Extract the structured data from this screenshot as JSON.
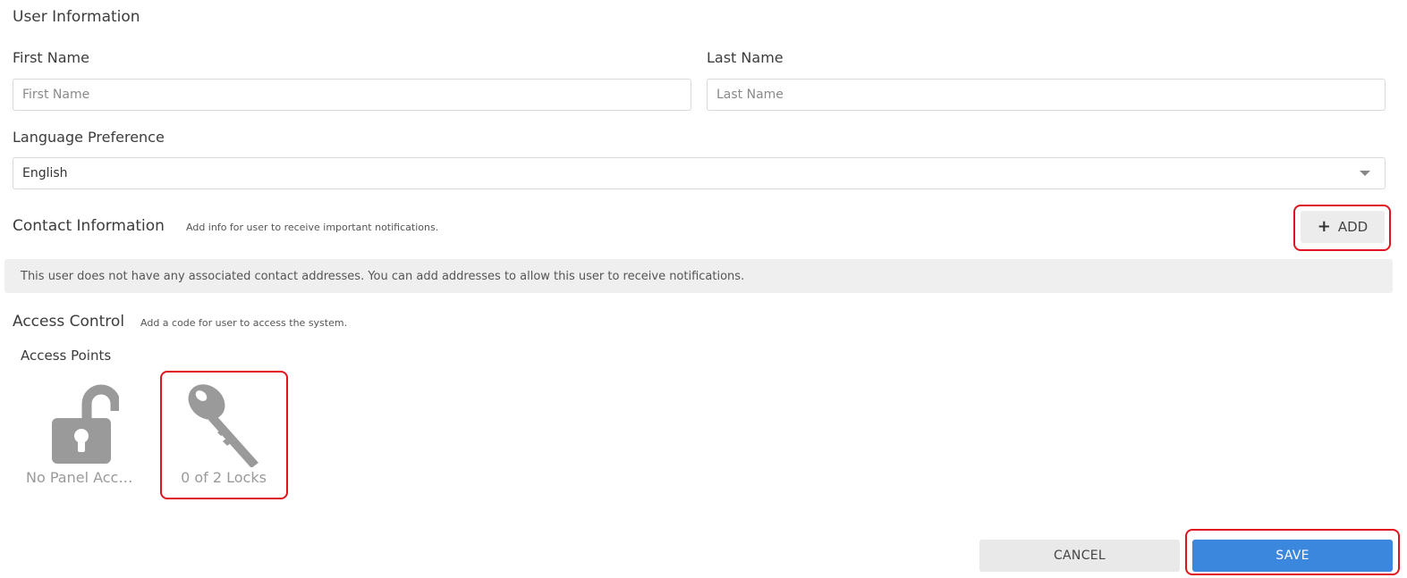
{
  "user_info": {
    "title": "User Information",
    "first_name": {
      "label": "First Name",
      "placeholder": "First Name",
      "value": ""
    },
    "last_name": {
      "label": "Last Name",
      "placeholder": "Last Name",
      "value": ""
    },
    "language": {
      "label": "Language Preference",
      "selected": "English"
    }
  },
  "contact_info": {
    "title": "Contact Information",
    "subtitle": "Add info for user to receive important notifications.",
    "add_label": "ADD",
    "empty_notice": "This user does not have any associated contact addresses. You can add addresses to allow this user to receive notifications."
  },
  "access_control": {
    "title": "Access Control",
    "subtitle": "Add a code for user to access the system.",
    "access_points_label": "Access Points",
    "tiles": [
      {
        "label": "No Panel Access",
        "icon": "unlocked-padlock-icon"
      },
      {
        "label": "0 of 2 Locks",
        "icon": "key-icon"
      }
    ]
  },
  "footer": {
    "cancel_label": "CANCEL",
    "save_label": "SAVE"
  },
  "colors": {
    "highlight": "#e0141e",
    "primary": "#3a87dd",
    "icon_gray": "#9a9a9a"
  }
}
